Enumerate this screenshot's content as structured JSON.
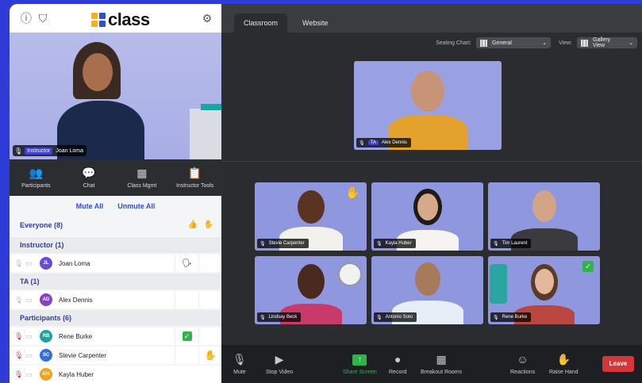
{
  "logo": {
    "word": "class",
    "colors": [
      "#f7b21b",
      "#2f4fd6",
      "#f7b21b",
      "#2f4fd6"
    ]
  },
  "header_icons": [
    "info-icon",
    "shield-icon",
    "gear-icon"
  ],
  "instructor_video": {
    "role": "Instructor",
    "name": "Joan Loma"
  },
  "side_tabs": [
    {
      "label": "Participants",
      "icon": "people-icon",
      "active": true
    },
    {
      "label": "Chat",
      "icon": "chat-icon"
    },
    {
      "label": "Class Mgmt",
      "icon": "class-mgmt-icon"
    },
    {
      "label": "Instructor Tools",
      "icon": "clipboard-icon"
    }
  ],
  "actions": {
    "mute_all": "Mute All",
    "unmute_all": "Unmute All"
  },
  "groups": {
    "everyone": "Everyone (8)",
    "instructor": "Instructor (1)",
    "ta": "TA (1)",
    "participants": "Participants (6)"
  },
  "people": {
    "joan": {
      "initials": "JL",
      "name": "Joan Loma",
      "color": "#6a4bd8"
    },
    "alex": {
      "initials": "AD",
      "name": "Alex Dennis",
      "color": "#8a3fc9"
    },
    "rene": {
      "initials": "RB",
      "name": "Rene Burke",
      "color": "#1aa5a5"
    },
    "stevie": {
      "initials": "SC",
      "name": "Stevie Carpenter",
      "color": "#2f6fe0"
    },
    "kayla": {
      "initials": "KH",
      "name": "Kayla Huber",
      "color": "#f7a21b"
    }
  },
  "top_tabs": {
    "classroom": "Classroom",
    "website": "Website"
  },
  "seating": {
    "label": "Seating Chart:",
    "value": "General"
  },
  "view": {
    "label": "View:",
    "value": "Gallery View"
  },
  "featured": {
    "role": "TA",
    "name": "Alex Dennis"
  },
  "tiles": [
    {
      "name": "Stevie Carpenter"
    },
    {
      "name": "Kayla Huber"
    },
    {
      "name": "Tim Laurent"
    },
    {
      "name": "Lindsay Beck"
    },
    {
      "name": "Antonio Soto"
    },
    {
      "name": "Rene Burke"
    }
  ],
  "controls": {
    "mute": "Mute",
    "stop_video": "Stop Video",
    "share_screen": "Share Screen",
    "record": "Record",
    "breakout": "Breakout Rooms",
    "reactions": "Reactions",
    "raise_hand": "Raise Hand",
    "leave": "Leave"
  },
  "accent": {
    "blue": "#2f4fd6",
    "green": "#2fb34a",
    "red": "#d6353a",
    "purple_bg": "#2f3bd6"
  }
}
